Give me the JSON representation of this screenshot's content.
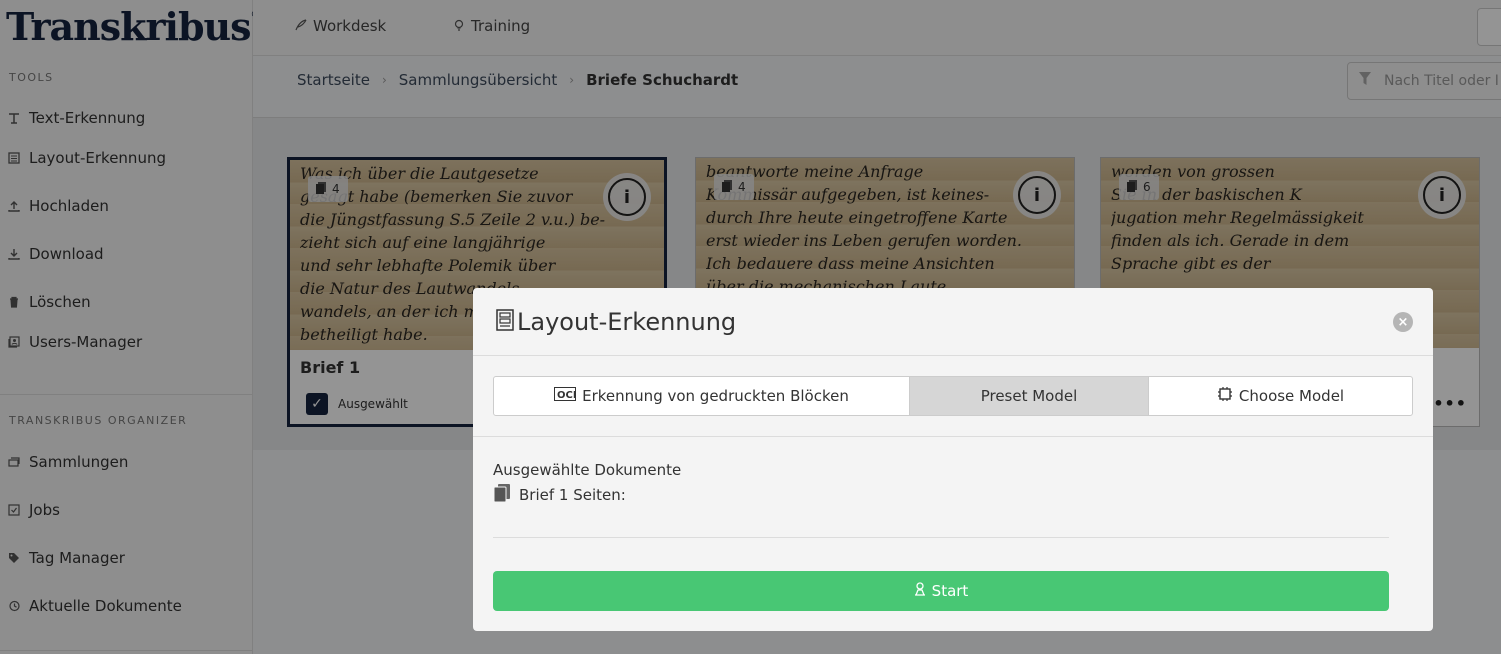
{
  "app": {
    "logo": "Transkribus",
    "logo_mark": "®"
  },
  "sidebar": {
    "tools_heading": "TOOLS",
    "tools": [
      {
        "label": "Text-Erkennung",
        "icon": "text-recognition-icon"
      },
      {
        "label": "Layout-Erkennung",
        "icon": "layout-icon"
      },
      {
        "label": "Hochladen",
        "icon": "upload-icon"
      },
      {
        "label": "Download",
        "icon": "download-icon"
      },
      {
        "label": "Löschen",
        "icon": "trash-icon"
      },
      {
        "label": "Users-Manager",
        "icon": "users-icon"
      }
    ],
    "organizer_heading": "TRANSKRIBUS ORGANIZER",
    "organizer": [
      {
        "label": "Sammlungen",
        "icon": "collections-icon"
      },
      {
        "label": "Jobs",
        "icon": "jobs-icon"
      },
      {
        "label": "Tag Manager",
        "icon": "tag-icon"
      },
      {
        "label": "Aktuelle Dokumente",
        "icon": "history-icon"
      }
    ]
  },
  "topnav": {
    "workdesk": "Workdesk",
    "training": "Training"
  },
  "breadcrumb": {
    "home": "Startseite",
    "overview": "Sammlungsübersicht",
    "current": "Briefe Schuchardt"
  },
  "filter": {
    "placeholder": "Nach Titel oder I"
  },
  "cards": [
    {
      "pages": "4",
      "title": "Brief 1",
      "selected_label": "Ausgewählt",
      "selected": true
    },
    {
      "pages": "4"
    },
    {
      "pages": "6"
    }
  ],
  "modal": {
    "title": "Layout-Erkennung",
    "tabs": [
      {
        "label": "Erkennung von gedruckten Blöcken",
        "icon": "ocr-icon"
      },
      {
        "label": "Preset Model",
        "active": true
      },
      {
        "label": "Choose Model",
        "icon": "chip-icon"
      }
    ],
    "selected_docs_label": "Ausgewählte Dokumente",
    "doc_line": "Brief 1 Seiten:",
    "start": "Start"
  },
  "colors": {
    "brand": "#15243f",
    "start_green": "#48c774"
  }
}
